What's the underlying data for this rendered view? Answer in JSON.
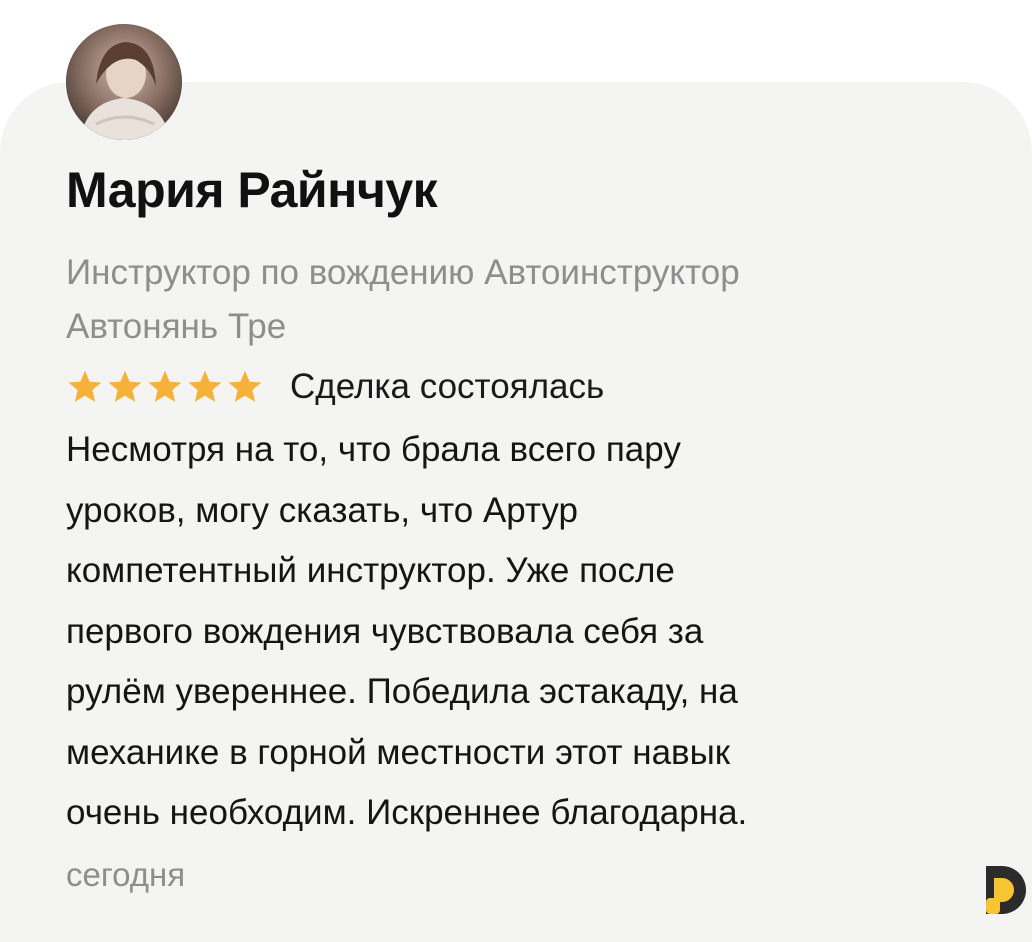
{
  "review_card": {
    "author_name": "Мария Райнчук",
    "subtitle_lines": [
      "Инструктор по вождению Автоинструктор",
      "Автонянь Тре"
    ],
    "rating": 5,
    "rating_max": 5,
    "deal_status": "Сделка состоялась",
    "review_lines": [
      "Несмотря на то, что брала всего пару",
      "уроков, могу сказать, что Артур",
      "компетентный инструктор. Уже после",
      "первого вождения чувствовала себя за",
      "рулём увереннее. Победила эстакаду, на",
      "механике в горной местности этот навык",
      "очень необходим. Искреннее благодарна."
    ],
    "date": "сегодня"
  },
  "colors": {
    "card_background": "#f4f4f2",
    "star": "#f5b13a",
    "name": "#111111",
    "secondary_text": "#8e8e8e",
    "brand_yellow": "#f7c531",
    "brand_dark": "#2b2b2b"
  },
  "icons": {
    "avatar": "user-photo",
    "star": "star-icon",
    "brand": "brand-logo-icon"
  }
}
